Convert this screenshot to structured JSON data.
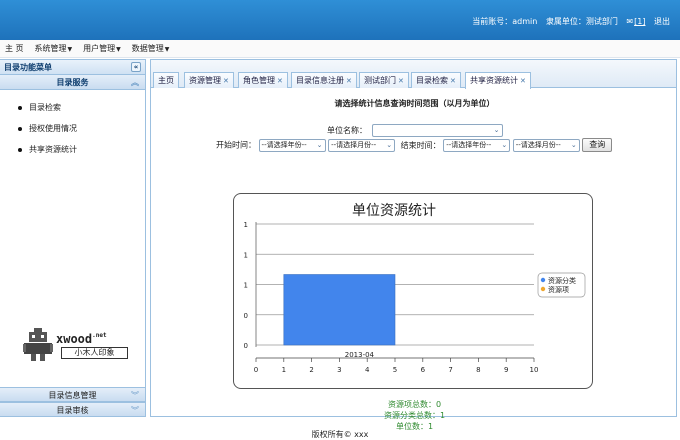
{
  "header": {
    "account_label": "当前账号：admin",
    "dept_label": "隶属单位：测试部门",
    "message_icon": "message-icon",
    "message_count": "[1]",
    "logout": "退出"
  },
  "menubar": {
    "items": [
      "主 页",
      "系统管理",
      "用户管理",
      "数据管理"
    ]
  },
  "sidebar": {
    "title": "目录功能菜单",
    "section_title": "目录服务",
    "items": [
      "目录检索",
      "授权使用情况",
      "共享资源统计"
    ],
    "bottom_sections": [
      "目录信息管理",
      "目录审核"
    ],
    "logo_brand": "xwood",
    "logo_brand_suffix": ".net",
    "logo_sub": "小木人印象"
  },
  "tabs": [
    {
      "label": "主页",
      "closable": false
    },
    {
      "label": "资源管理",
      "closable": true
    },
    {
      "label": "角色管理",
      "closable": true
    },
    {
      "label": "目录信息注册",
      "closable": true
    },
    {
      "label": "测试部门",
      "closable": true
    },
    {
      "label": "目录检索",
      "closable": true
    },
    {
      "label": "共享资源统计",
      "closable": true,
      "active": true
    }
  ],
  "form": {
    "title": "请选择统计信息查询时间范围（以月为单位）",
    "unit_label": "单位名称：",
    "unit_value": "",
    "start_label": "开始时间：",
    "start_year": "--请选择年份--",
    "start_month": "--请选择月份--",
    "end_label": "结束时间：",
    "end_year": "--请选择年份--",
    "end_month": "--请选择月份--",
    "query_button": "查询"
  },
  "chart_data": {
    "type": "bar",
    "orientation": "horizontal",
    "title": "单位资源统计",
    "categories": [
      "2013-04"
    ],
    "series": [
      {
        "name": "资源分类",
        "values": [
          4
        ],
        "color": "#4285ec"
      },
      {
        "name": "资源项",
        "values": [
          0
        ],
        "color": "#f0a830"
      }
    ],
    "xlim": [
      0,
      10
    ],
    "x_ticks": [
      "0",
      "1",
      "2",
      "3",
      "4",
      "5",
      "6",
      "7",
      "8",
      "9",
      "10"
    ],
    "y_ticks": [
      "0",
      "0",
      "1",
      "1",
      "1"
    ],
    "bar_start": 1,
    "bar_end": 5,
    "grid": true,
    "legend_position": "right"
  },
  "stats": {
    "items": [
      "资源项总数：0",
      "资源分类总数：1",
      "单位数：1"
    ]
  },
  "footer": {
    "copyright": "版权所有© xxx"
  },
  "colors": {
    "header": "#1e72bb",
    "accent": "#4285ec",
    "stats_text": "#2f8a2f"
  }
}
